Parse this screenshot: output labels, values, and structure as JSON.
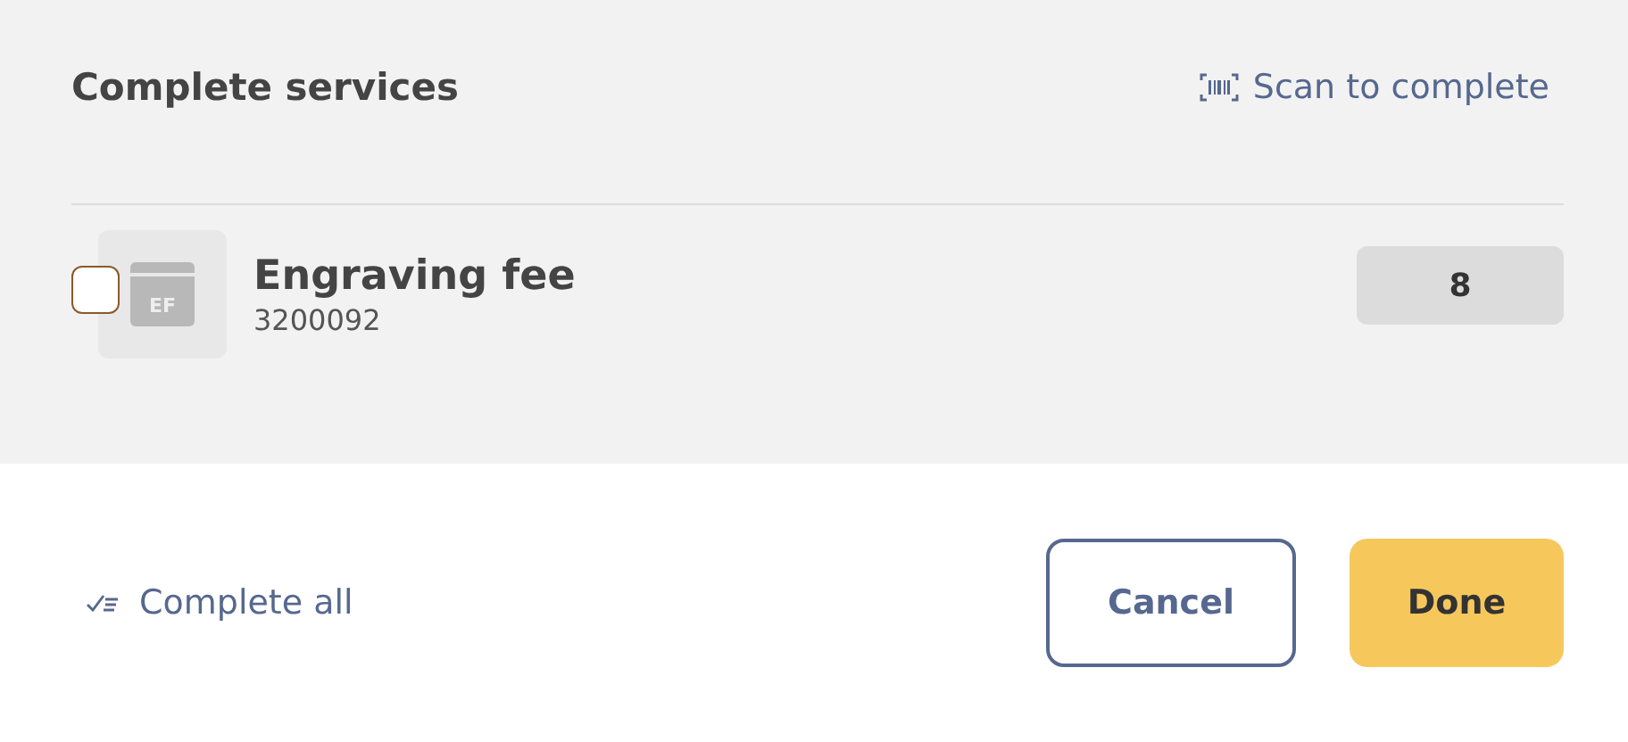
{
  "header": {
    "title": "Complete services",
    "scan_link": "Scan to complete"
  },
  "services": [
    {
      "checked": false,
      "thumb_label": "EF",
      "name": "Engraving fee",
      "code": "3200092",
      "quantity": "8"
    }
  ],
  "footer": {
    "complete_all": "Complete all",
    "buttons": [
      {
        "kind": "secondary",
        "label": "Cancel"
      },
      {
        "kind": "primary",
        "label": "Done"
      }
    ]
  }
}
